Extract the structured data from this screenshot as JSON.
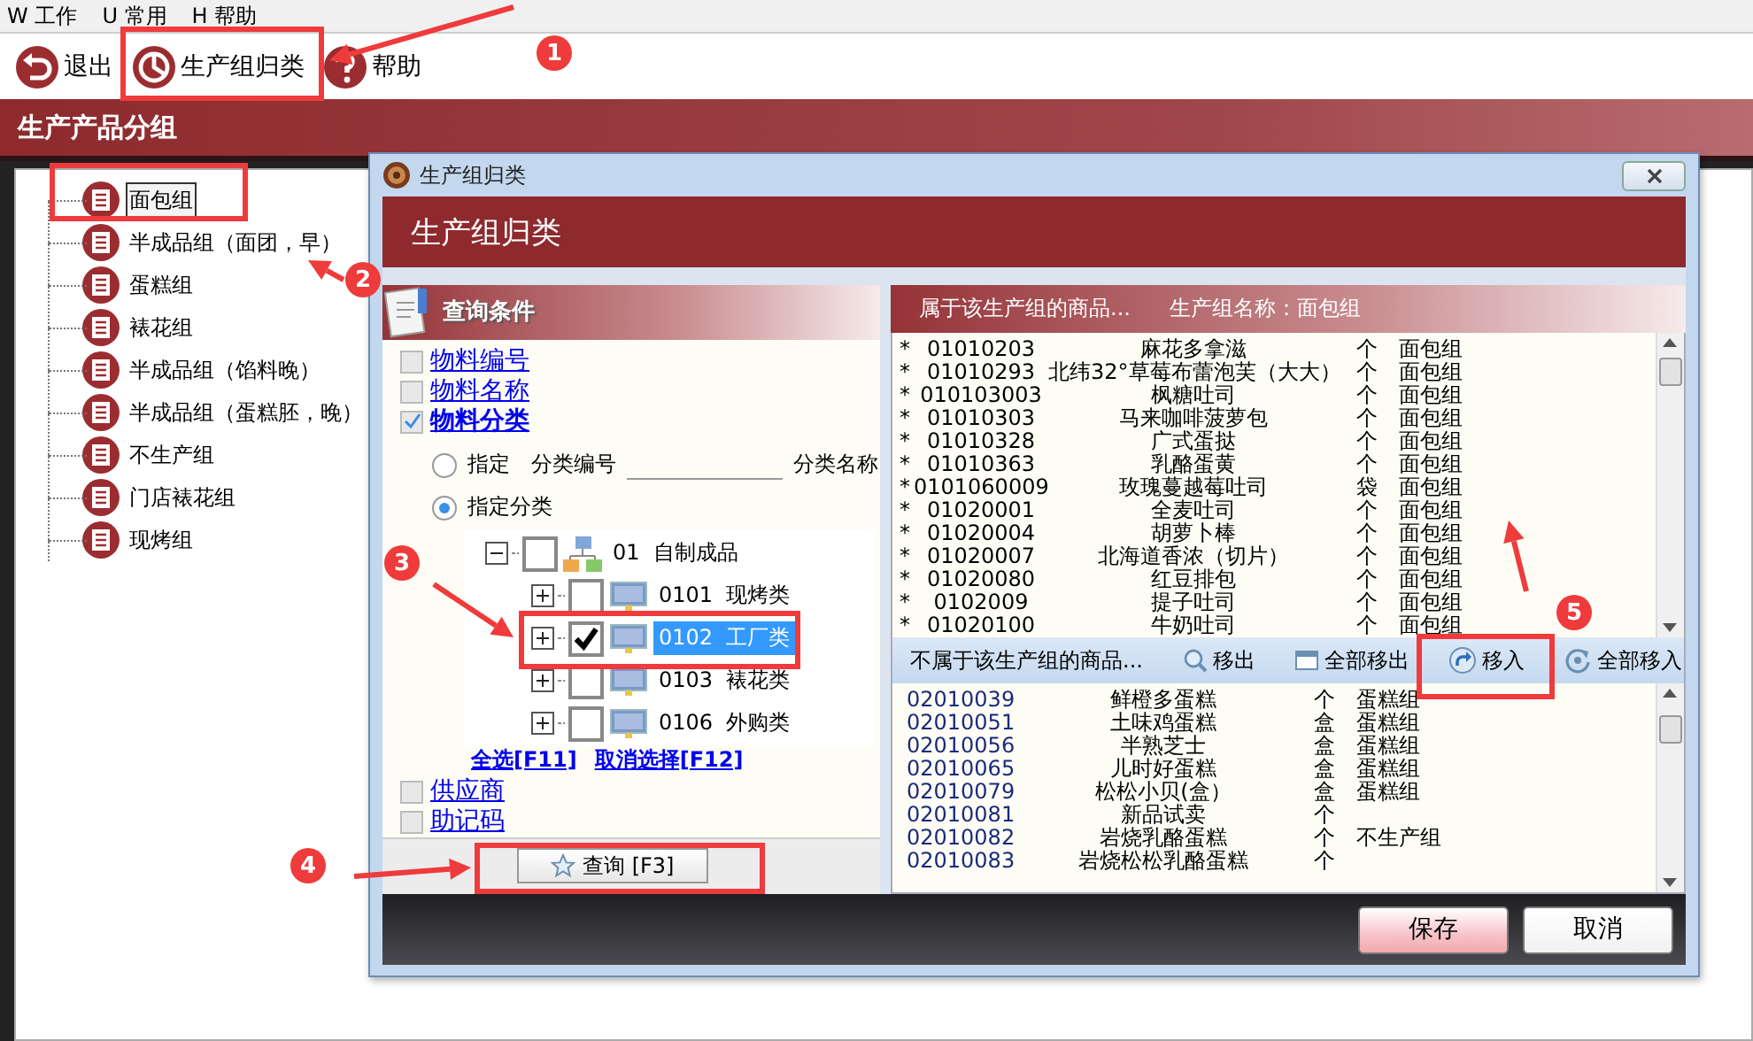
{
  "menu": [
    "W 工作",
    "U 常用",
    "H 帮助"
  ],
  "toolbar": [
    {
      "label": "退出",
      "kind": "exit"
    },
    {
      "label": "生产组归类",
      "kind": "classify"
    },
    {
      "label": "帮助",
      "kind": "help"
    }
  ],
  "panel_title": "生产产品分组",
  "groups": [
    {
      "label": "面包组",
      "selected": true
    },
    {
      "label": "半成品组（面团，早）",
      "selected": false
    },
    {
      "label": "蛋糕组",
      "selected": false
    },
    {
      "label": "裱花组",
      "selected": false
    },
    {
      "label": "半成品组（馅料晚）",
      "selected": false
    },
    {
      "label": "半成品组（蛋糕胚，晚）",
      "selected": false
    },
    {
      "label": "不生产组",
      "selected": false
    },
    {
      "label": "门店裱花组",
      "selected": false
    },
    {
      "label": "现烤组",
      "selected": false
    }
  ],
  "dialog": {
    "title": "生产组归类",
    "heading": "生产组归类",
    "query": {
      "title": "查询条件",
      "fields": [
        {
          "label": "物料编号",
          "checked": false
        },
        {
          "label": "物料名称",
          "checked": false
        },
        {
          "label": "物料分类",
          "checked": true
        }
      ],
      "modes": [
        {
          "label": "指定",
          "selected": false
        },
        {
          "label": "指定分类",
          "selected": true
        }
      ],
      "code_label": "分类编号",
      "name_label": "分类名称",
      "categories": [
        {
          "code": "01",
          "name": "自制成品",
          "checked": false,
          "selected": false,
          "expanded": true,
          "children": [
            {
              "code": "0101",
              "name": "现烤类",
              "checked": false,
              "selected": false,
              "expanded": false
            },
            {
              "code": "0102",
              "name": "工厂类",
              "checked": true,
              "selected": true,
              "expanded": false
            },
            {
              "code": "0103",
              "name": "裱花类",
              "checked": false,
              "selected": false,
              "expanded": false
            },
            {
              "code": "0106",
              "name": "外购类",
              "checked": false,
              "selected": false,
              "expanded": false
            }
          ]
        }
      ],
      "links": [
        "全选[F11]",
        "取消选择[F12]"
      ],
      "extra_fields": [
        {
          "label": "供应商",
          "checked": false
        },
        {
          "label": "助记码",
          "checked": false
        }
      ],
      "search_button": "查询 [F3]"
    },
    "in_group": {
      "title": "属于该生产组的商品...",
      "group_label": "生产组名称：面包组",
      "rows": [
        {
          "mark": "*",
          "code": "01010203",
          "name": "麻花多拿滋",
          "unit": "个",
          "group": "面包组"
        },
        {
          "mark": "*",
          "code": "01010293",
          "name": "北纬32°草莓布蕾泡芙（大大）",
          "unit": "个",
          "group": "面包组"
        },
        {
          "mark": "*",
          "code": "010103003",
          "name": "枫糖吐司",
          "unit": "个",
          "group": "面包组"
        },
        {
          "mark": "*",
          "code": "01010303",
          "name": "马来咖啡菠萝包",
          "unit": "个",
          "group": "面包组"
        },
        {
          "mark": "*",
          "code": "01010328",
          "name": "广式蛋挞",
          "unit": "个",
          "group": "面包组"
        },
        {
          "mark": "*",
          "code": "01010363",
          "name": "乳酪蛋黄",
          "unit": "个",
          "group": "面包组"
        },
        {
          "mark": "*",
          "code": "0101060009",
          "name": "玫瑰蔓越莓吐司",
          "unit": "袋",
          "group": "面包组"
        },
        {
          "mark": "*",
          "code": "01020001",
          "name": "全麦吐司",
          "unit": "个",
          "group": "面包组"
        },
        {
          "mark": "*",
          "code": "01020004",
          "name": "胡萝卜棒",
          "unit": "个",
          "group": "面包组"
        },
        {
          "mark": "*",
          "code": "01020007",
          "name": "北海道香浓（切片）",
          "unit": "个",
          "group": "面包组"
        },
        {
          "mark": "*",
          "code": "01020080",
          "name": "红豆排包",
          "unit": "个",
          "group": "面包组"
        },
        {
          "mark": "*",
          "code": "0102009",
          "name": "提子吐司",
          "unit": "个",
          "group": "面包组"
        },
        {
          "mark": "*",
          "code": "01020100",
          "name": "牛奶吐司",
          "unit": "个",
          "group": "面包组"
        }
      ]
    },
    "out_group": {
      "title": "不属于该生产组的商品...",
      "actions": [
        {
          "label": "移出",
          "kind": "remove"
        },
        {
          "label": "全部移出",
          "kind": "remove_all"
        },
        {
          "label": "移入",
          "kind": "add"
        },
        {
          "label": "全部移入",
          "kind": "add_all"
        }
      ],
      "rows": [
        {
          "code": "02010039",
          "name": "鲜橙多蛋糕",
          "unit": "个",
          "group": "蛋糕组"
        },
        {
          "code": "02010051",
          "name": "土味鸡蛋糕",
          "unit": "盒",
          "group": "蛋糕组"
        },
        {
          "code": "02010056",
          "name": "半熟芝士",
          "unit": "盒",
          "group": "蛋糕组"
        },
        {
          "code": "02010065",
          "name": "儿时好蛋糕",
          "unit": "盒",
          "group": "蛋糕组"
        },
        {
          "code": "02010079",
          "name": "松松小贝(盒）",
          "unit": "盒",
          "group": "蛋糕组"
        },
        {
          "code": "02010081",
          "name": "新品试卖",
          "unit": "个"
        },
        {
          "code": "02010082",
          "name": "岩烧乳酪蛋糕",
          "unit": "个",
          "group": "不生产组"
        },
        {
          "code": "02010083",
          "name": "岩烧松松乳酪蛋糕",
          "unit": "个"
        }
      ]
    },
    "buttons": [
      {
        "label": "保存",
        "kind": "primary"
      },
      {
        "label": "取消",
        "kind": "secondary"
      }
    ]
  },
  "annotations": [
    "1",
    "2",
    "3",
    "4",
    "5"
  ]
}
